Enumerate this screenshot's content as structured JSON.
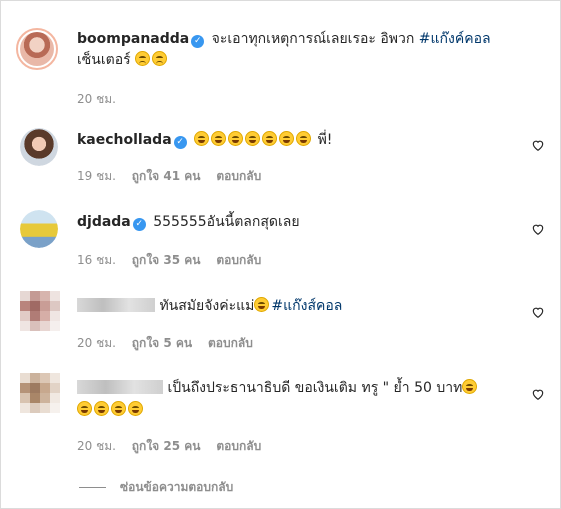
{
  "caption": {
    "username": "boompanadda",
    "text": "จะเอาทุกเหตุการณ์เลยเรอะ อิพวก ",
    "hashtag": "#แก๊งค์คอล",
    "text2": "เซ็นเตอร์",
    "time": "20 ชม."
  },
  "comments": [
    {
      "username": "kaechollada",
      "text": "พี่!",
      "time": "19 ชม.",
      "likes": "ถูกใจ 41 คน",
      "reply": "ตอบกลับ"
    },
    {
      "username": "djdada",
      "text": "555555อันนี้ตลกสุดเลย",
      "time": "16 ชม.",
      "likes": "ถูกใจ 35 คน",
      "reply": "ตอบกลับ"
    },
    {
      "text": "ทันสมัยจังค่ะแม่",
      "hashtag": "#แก๊งส์คอล",
      "time": "20 ชม.",
      "likes": "ถูกใจ 5 คน",
      "reply": "ตอบกลับ"
    },
    {
      "text": "เป็นถึงประธานาธิบดี ขอเงินเติม ทรู \" ย้ำ 50 บาท",
      "time": "20 ชม.",
      "likes": "ถูกใจ 25 คน",
      "reply": "ตอบกลับ"
    }
  ],
  "hide_replies": "ซ่อนข้อความตอบกลับ",
  "icons": {
    "verified": "verified-badge-icon",
    "heart": "heart-outline-icon",
    "emoji": "laughing-emoji-icon"
  },
  "colors": {
    "username": "#262626",
    "hashtag": "#00376b",
    "meta": "#8e8e8e",
    "verified": "#3897f0"
  }
}
